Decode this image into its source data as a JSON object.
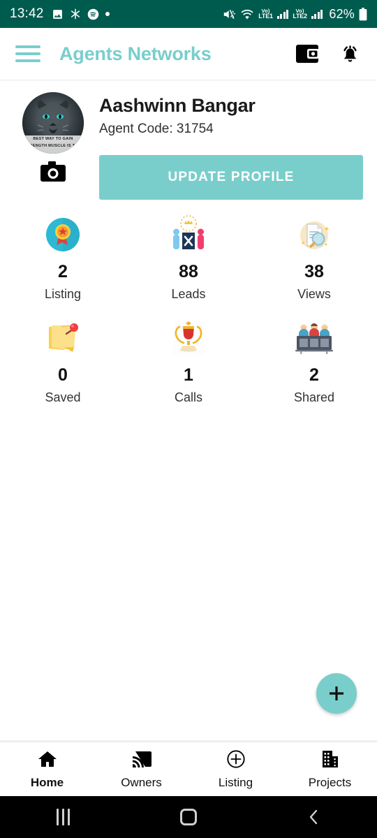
{
  "status_bar": {
    "time": "13:42",
    "icons": [
      "image-icon",
      "snowflake-icon",
      "spotify-icon",
      "dot-icon"
    ],
    "right_icons": [
      "mute-icon",
      "wifi-icon",
      "volte-lte1-icon",
      "signal-bars-icon",
      "volte-lte2-icon",
      "signal-bars-icon"
    ],
    "volte_label": "Vo)",
    "lte1_label": "LTE1",
    "lte2_label": "LTE2",
    "battery": "62%",
    "background": "#005b4f"
  },
  "app_bar": {
    "menu_icon": "hamburger-menu-icon",
    "title": "Agents Networks",
    "title_color": "#79cecb",
    "actions": [
      {
        "name": "wallet-icon"
      },
      {
        "name": "notification-bell-icon"
      }
    ]
  },
  "profile": {
    "avatar_alt": "lion-profile-photo",
    "avatar_caption": "BEST WAY TO GAIN STRENGTH MUSCLE IS TO...",
    "camera_icon": "camera-icon",
    "name": "Aashwinn Bangar",
    "agent_code": "Agent Code: 31754",
    "update_button": "UPDATE PROFILE",
    "accent": "#79cecb"
  },
  "stats": [
    {
      "icon": "award-badge-icon",
      "value": "2",
      "label": "Listing"
    },
    {
      "icon": "leads-people-icon",
      "value": "88",
      "label": "Leads"
    },
    {
      "icon": "document-search-icon",
      "value": "38",
      "label": "Views"
    },
    {
      "icon": "sticky-note-pin-icon",
      "value": "0",
      "label": "Saved"
    },
    {
      "icon": "trophy-icon",
      "value": "1",
      "label": "Calls"
    },
    {
      "icon": "team-desk-icon",
      "value": "2",
      "label": "Shared"
    }
  ],
  "fab": {
    "icon": "plus-icon",
    "color": "#79cecb"
  },
  "bottom_nav": [
    {
      "icon": "home-icon",
      "label": "Home",
      "active": true
    },
    {
      "icon": "cast-icon",
      "label": "Owners",
      "active": false
    },
    {
      "icon": "plus-circle-icon",
      "label": "Listing",
      "active": false
    },
    {
      "icon": "building-icon",
      "label": "Projects",
      "active": false
    }
  ],
  "system_nav": {
    "recents": "recents-icon",
    "home": "home-button-icon",
    "back": "back-icon"
  }
}
